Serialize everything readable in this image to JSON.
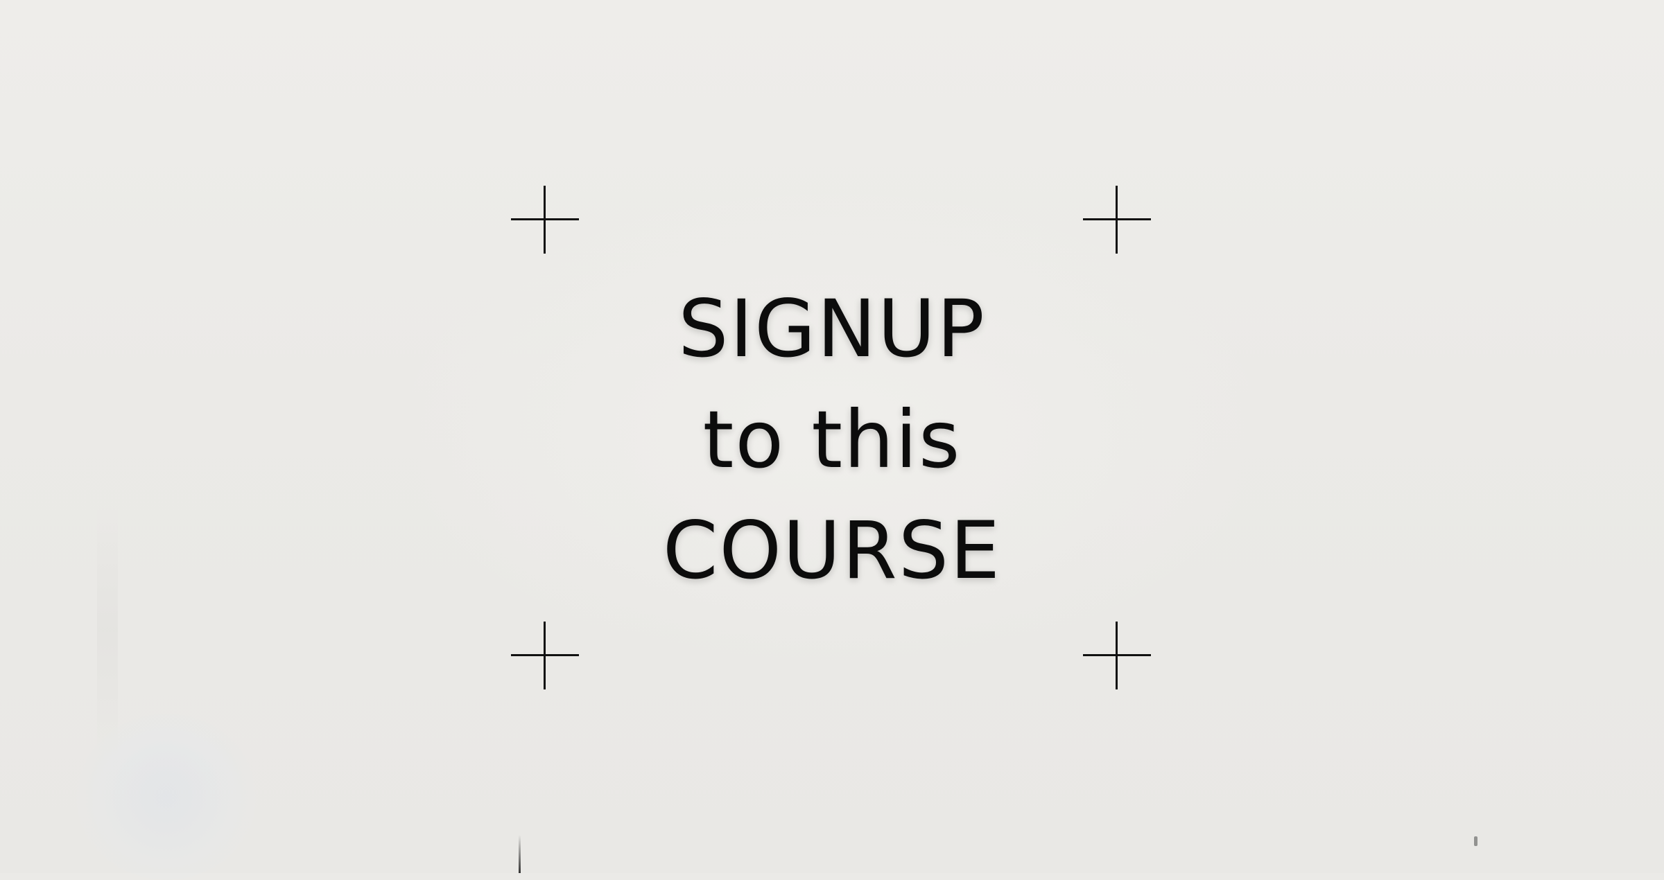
{
  "promo": {
    "line1": "SIGNUP",
    "line2": "to this",
    "line3": "COURSE"
  },
  "icons": {
    "corner_marks": [
      "crosshair-icon",
      "crosshair-icon",
      "crosshair-icon",
      "crosshair-icon"
    ]
  },
  "colors": {
    "background": "#ebeae7",
    "text": "#0c0c0c",
    "marks": "#111111"
  }
}
